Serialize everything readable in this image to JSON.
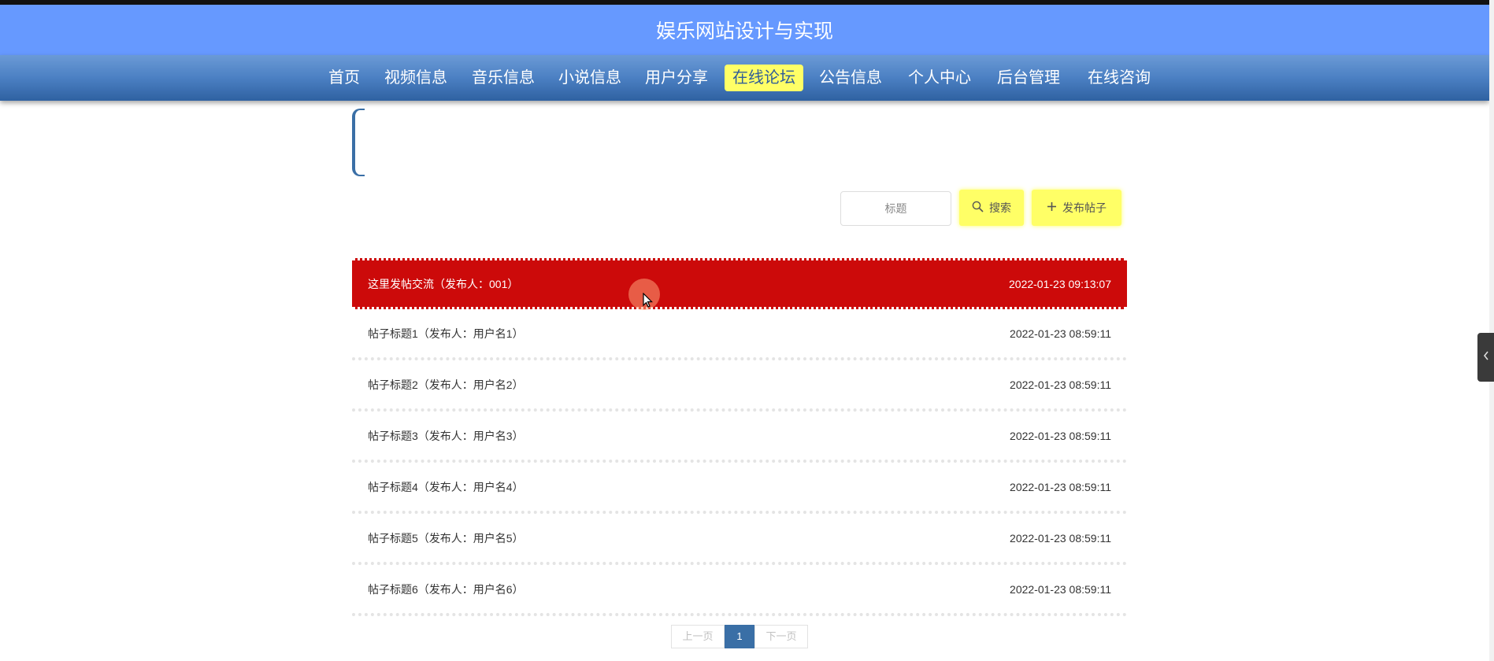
{
  "site": {
    "title": "娱乐网站设计与实现"
  },
  "nav": {
    "items": [
      {
        "label": "首页",
        "active": false
      },
      {
        "label": "视频信息",
        "active": false
      },
      {
        "label": "音乐信息",
        "active": false
      },
      {
        "label": "小说信息",
        "active": false
      },
      {
        "label": "用户分享",
        "active": false
      },
      {
        "label": "在线论坛",
        "active": true
      },
      {
        "label": "公告信息",
        "active": false
      },
      {
        "label": "个人中心",
        "active": false
      },
      {
        "label": "后台管理",
        "active": false
      },
      {
        "label": "在线咨询",
        "active": false
      }
    ],
    "active_color": "#ffff66"
  },
  "search": {
    "placeholder": "标题",
    "search_label": "搜索",
    "search_icon": "search-icon",
    "post_label": "发布帖子",
    "post_icon": "plus-icon"
  },
  "posts": [
    {
      "title": "这里发帖交流（发布人：001）",
      "date": "2022-01-23 09:13:07",
      "highlighted": true
    },
    {
      "title": "帖子标题1（发布人：用户名1）",
      "date": "2022-01-23 08:59:11",
      "highlighted": false
    },
    {
      "title": "帖子标题2（发布人：用户名2）",
      "date": "2022-01-23 08:59:11",
      "highlighted": false
    },
    {
      "title": "帖子标题3（发布人：用户名3）",
      "date": "2022-01-23 08:59:11",
      "highlighted": false
    },
    {
      "title": "帖子标题4（发布人：用户名4）",
      "date": "2022-01-23 08:59:11",
      "highlighted": false
    },
    {
      "title": "帖子标题5（发布人：用户名5）",
      "date": "2022-01-23 08:59:11",
      "highlighted": false
    },
    {
      "title": "帖子标题6（发布人：用户名6）",
      "date": "2022-01-23 08:59:11",
      "highlighted": false
    }
  ],
  "pagination": {
    "prev": "上一页",
    "current": "1",
    "next": "下一页"
  },
  "colors": {
    "header": "#6699ff",
    "navbar": "#4b80c3",
    "highlight_row": "#cc0a0a",
    "button": "#ffff66",
    "page_active": "#3a6fa6"
  },
  "side_tab": {
    "icon": "chevron-left-icon"
  }
}
